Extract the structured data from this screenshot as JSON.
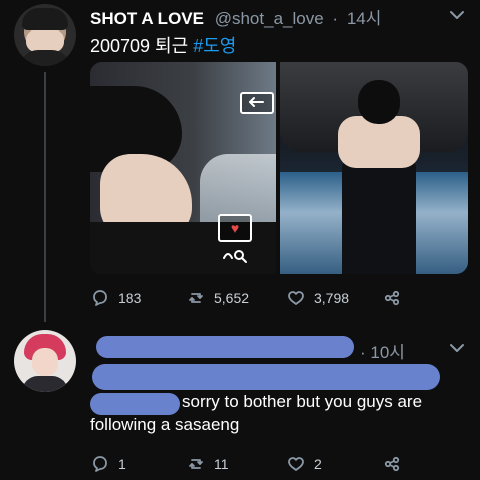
{
  "tweet": {
    "display_name": "SHOT A LOVE",
    "handle": "@shot_a_love",
    "separator": "·",
    "time": "14시",
    "text_prefix": "200709 퇴근",
    "hashtag": "#도영",
    "media": {
      "photos": 2
    },
    "actions": {
      "replies": "183",
      "retweets": "5,652",
      "likes": "3,798"
    }
  },
  "reply": {
    "separator_time": "· 10시",
    "text_line1": "sorry to bother but you guys are",
    "text_line2": "following a sasaeng",
    "actions": {
      "replies": "1",
      "retweets": "11",
      "likes": "2"
    }
  },
  "icons": {
    "reply": "reply-icon",
    "retweet": "retweet-icon",
    "like": "heart-icon",
    "share": "share-icon",
    "more": "chevron-down-icon"
  },
  "colors": {
    "background": "#0e0e0e",
    "muted": "#8b98a5",
    "hashtag": "#1d9bf0",
    "redaction": "#6f89d8"
  }
}
